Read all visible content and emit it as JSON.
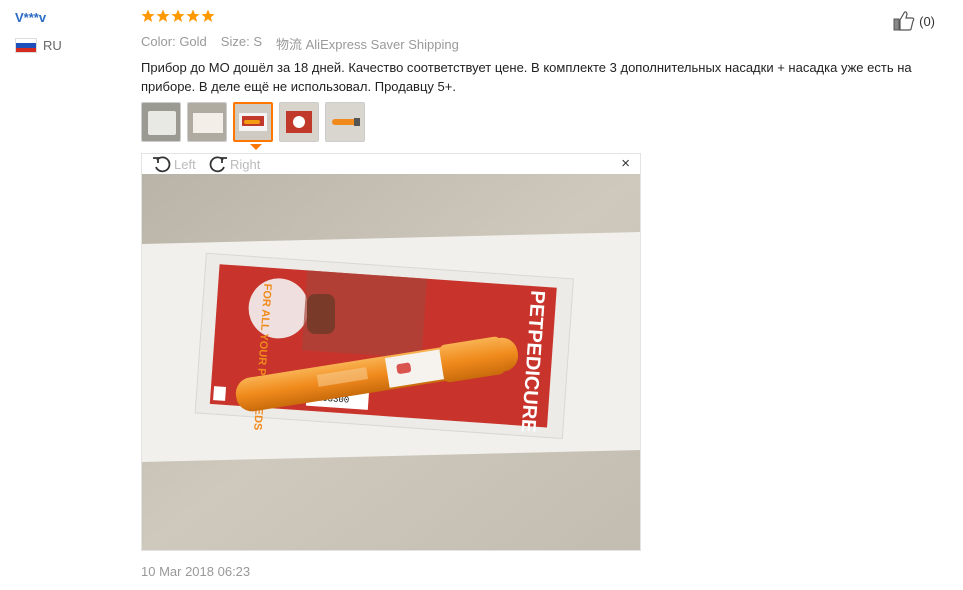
{
  "reviewer": {
    "name": "V***v",
    "country": "RU"
  },
  "rating": {
    "stars": 5,
    "max": 5,
    "color": "#ff9900"
  },
  "meta": {
    "color_label": "Color:",
    "color_value": "Gold",
    "size_label": "Size:",
    "size_value": "S",
    "shipping_label": "物流",
    "shipping_value": "AliExpress Saver Shipping"
  },
  "like": {
    "count": "(0)"
  },
  "review": {
    "text": "Прибор до МО дошёл за 18 дней. Качество соответствует цене. В комплекте 3 дополнительных насадки + насадка уже есть на приборе. В деле ещё не использовал. Продавцу 5+."
  },
  "thumbnails": {
    "count": 5,
    "active_index": 2,
    "accent": "#ff7700"
  },
  "viewer": {
    "rotate_left": "Left",
    "rotate_right": "Right",
    "close": "×"
  },
  "product_photo": {
    "brand": "PETPEDICURE",
    "slogan": "FOR ALL YOUR PET NEEDS",
    "barcode": "2103300"
  },
  "date": "10 Mar 2018 06:23"
}
